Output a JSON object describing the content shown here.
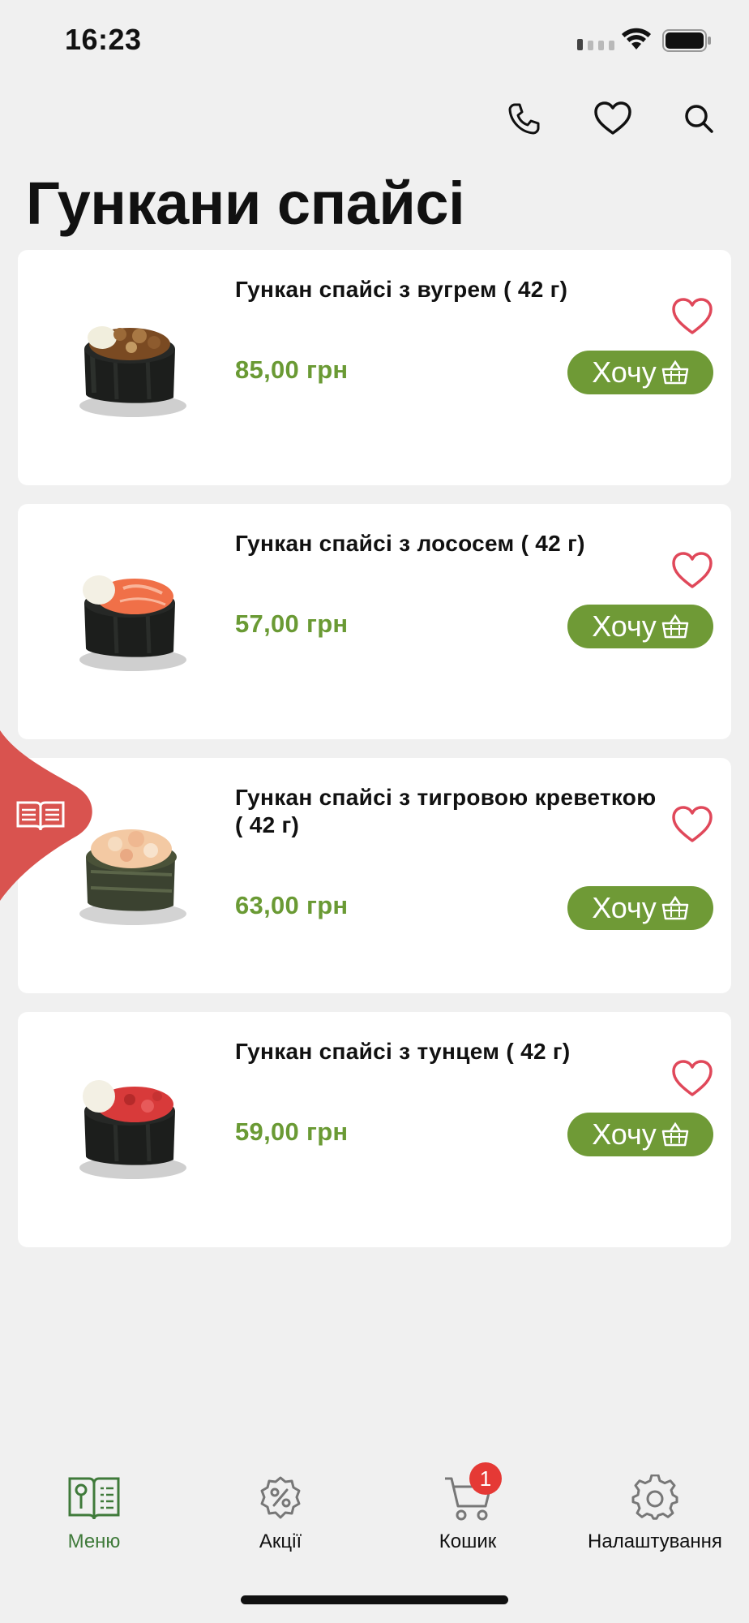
{
  "status_bar": {
    "time": "16:23"
  },
  "header": {
    "title": "Гункани спайсі",
    "icons": [
      "phone-icon",
      "heart-icon",
      "search-icon"
    ]
  },
  "products": [
    {
      "name": "Гункан спайсі з вугрем ( 42 г)",
      "price": "85,00 грн",
      "button_label": "Хочу",
      "topping_color": "#7a4a22"
    },
    {
      "name": "Гункан спайсі з лососем ( 42 г)",
      "price": "57,00 грн",
      "button_label": "Хочу",
      "topping_color": "#f07048"
    },
    {
      "name": "Гункан спайсі з тигровою креветкою ( 42 г)",
      "price": "63,00 грн",
      "button_label": "Хочу",
      "topping_color": "#f3c9a3"
    },
    {
      "name": "Гункан спайсі з тунцем ( 42 г)",
      "price": "59,00 грн",
      "button_label": "Хочу",
      "topping_color": "#d83a3a"
    }
  ],
  "bottom_nav": {
    "items": [
      {
        "label": "Меню",
        "icon": "menu-book-icon",
        "active": true
      },
      {
        "label": "Акції",
        "icon": "discount-icon",
        "active": false
      },
      {
        "label": "Кошик",
        "icon": "cart-icon",
        "active": false,
        "badge": "1"
      },
      {
        "label": "Налаштування",
        "icon": "settings-icon",
        "active": false
      }
    ]
  },
  "colors": {
    "accent_green": "#6f9a36",
    "price_green": "#6a9a34",
    "favorite_red": "#e0485a",
    "side_tab_red": "#d9534f",
    "badge_red": "#e53935",
    "background": "#f0f0f0"
  }
}
